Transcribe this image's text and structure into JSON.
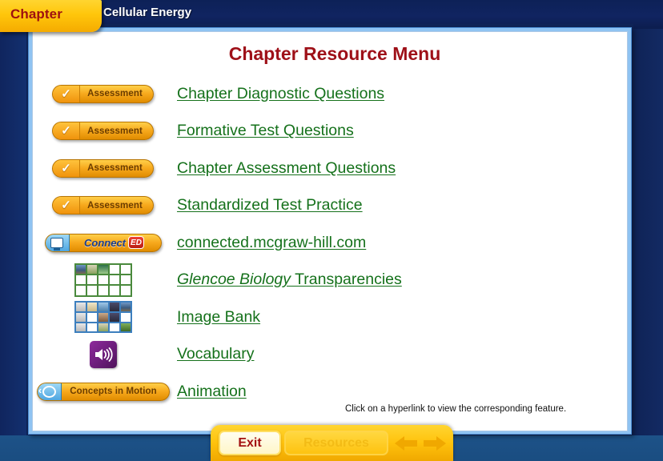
{
  "header": {
    "chapter_tab_label": "Chapter",
    "chapter_title": "Cellular Energy"
  },
  "main": {
    "page_title": "Chapter Resource Menu",
    "footer_note": "Click on a hyperlink to view the corresponding feature.",
    "rows": [
      {
        "icon": "assessment-pill-icon",
        "icon_label": "Assessment",
        "link": "Chapter Diagnostic Questions"
      },
      {
        "icon": "assessment-pill-icon",
        "icon_label": "Assessment",
        "link": "Formative Test Questions"
      },
      {
        "icon": "assessment-pill-icon",
        "icon_label": "Assessment",
        "link": "Chapter Assessment Questions"
      },
      {
        "icon": "assessment-pill-icon",
        "icon_label": "Assessment",
        "link": "Standardized Test Practice"
      },
      {
        "icon": "connect-ed-pill-icon",
        "icon_label": "Connect",
        "icon_label_2": "ED",
        "link": "connected.mcgraw-hill.com"
      },
      {
        "icon": "transparencies-grid-icon",
        "link_italic": "Glencoe Biology",
        "link": " Transparencies"
      },
      {
        "icon": "image-bank-grid-icon",
        "link": "Image Bank"
      },
      {
        "icon": "speaker-icon",
        "link": "Vocabulary"
      },
      {
        "icon": "concepts-in-motion-pill-icon",
        "icon_label": "Concepts in Motion",
        "link": "Animation"
      }
    ]
  },
  "navbar": {
    "exit_label": "Exit",
    "resources_label": "Resources",
    "back_arrow": "back-arrow-icon",
    "forward_arrow": "forward-arrow-icon"
  },
  "colors": {
    "navy": "#0f2356",
    "gold": "#ffc20c",
    "link_green": "#15711b",
    "title_red": "#9e1018",
    "bottom_band_blue": "#1d5288"
  }
}
